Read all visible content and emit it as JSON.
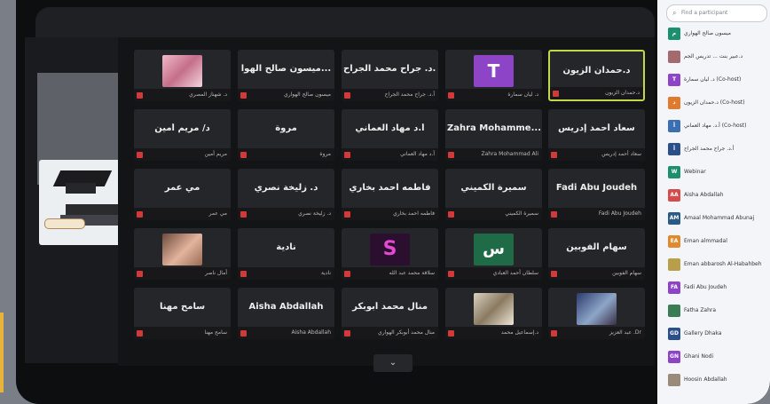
{
  "search": {
    "placeholder": "Find a participant"
  },
  "tiles": [
    {
      "name": "",
      "caption": "د. شهناز المصري",
      "avatar": "photo-pink"
    },
    {
      "name": "ميسون صالح الهوا...",
      "caption": "ميسون صالح الهواري",
      "avatar": null
    },
    {
      "name": "أ.د. جراح محمد الجراح",
      "caption": "أ.د. جراح محمد الجراح",
      "avatar": null
    },
    {
      "name": "",
      "caption": "د. ليان سمارة",
      "avatar": "purpleT",
      "letter": "T"
    },
    {
      "name": "د.حمدان الزيون",
      "caption": "د.حمدان الزيون",
      "avatar": null,
      "selected": true
    },
    {
      "name": "د/ مريم أمين",
      "caption": "مريم أمين",
      "avatar": null
    },
    {
      "name": "مروة",
      "caption": "مروة",
      "avatar": null
    },
    {
      "name": "أ.د مهاد العماني",
      "caption": "أ.د مهاد العماني",
      "avatar": null
    },
    {
      "name": "Zahra Mohamme...",
      "caption": "Zahra Mohammad Ali",
      "avatar": null
    },
    {
      "name": "سعاد أحمد إدريس",
      "caption": "سعاد أحمد إدريس",
      "avatar": null
    },
    {
      "name": "مي عمر",
      "caption": "مي عمر",
      "avatar": null
    },
    {
      "name": "د. زليخة نصري",
      "caption": "د. زليخة نصري",
      "avatar": null
    },
    {
      "name": "فاطمه احمد بخاري",
      "caption": "فاطمه احمد بخاري",
      "avatar": null
    },
    {
      "name": "سميرة الكميني",
      "caption": "سميرة الكميني",
      "avatar": null
    },
    {
      "name": "Fadi Abu Joudeh",
      "caption": "Fadi Abu Joudeh",
      "avatar": null
    },
    {
      "name": "",
      "caption": "أمال ناصر",
      "avatar": "photo-warm"
    },
    {
      "name": "نادية",
      "caption": "نادية",
      "avatar": null
    },
    {
      "name": "",
      "caption": "سلافة محمد عبد الله",
      "avatar": "purpleS",
      "letter": "S"
    },
    {
      "name": "",
      "caption": "سلطان أحمد العبادي",
      "avatar": "green",
      "letter": "س"
    },
    {
      "name": "سهام الفوبين",
      "caption": "سهام الفوبين",
      "avatar": null
    },
    {
      "name": "سامح مهنا",
      "caption": "سامح مهنا",
      "avatar": null
    },
    {
      "name": "Aisha Abdallah",
      "caption": "Aisha Abdallah",
      "avatar": null
    },
    {
      "name": "منال محمد أبوبكر",
      "caption": "منال محمد أبوبكر الهواري",
      "avatar": null
    },
    {
      "name": "",
      "caption": "د.إسماعيل محمد",
      "avatar": "photo-book"
    },
    {
      "name": "",
      "caption": "Dr. عبد العزيز",
      "avatar": "photo-blue"
    }
  ],
  "participants": [
    {
      "name": "ميسون صالح الهواري",
      "color": "#1c8f6e",
      "initials": "م"
    },
    {
      "name": "د.عبير بنت ... تدريس الجم",
      "color": "#a46a6f",
      "initials": ""
    },
    {
      "name": "د. ليان سمارة (Co-host)",
      "color": "#8d44c7",
      "initials": "T"
    },
    {
      "name": "د.حمدان الزيون (Co-host)",
      "color": "#e07b2e",
      "initials": "د"
    },
    {
      "name": "أ.د. مهاد العماني (Co-host)",
      "color": "#3b6fb3",
      "initials": "أ"
    },
    {
      "name": "أ.د. جراح محمد الجراح",
      "color": "#2a4f8a",
      "initials": "أ"
    },
    {
      "name": "Webinar",
      "color": "#1c8f6e",
      "initials": "W"
    },
    {
      "name": "Aisha Abdallah",
      "color": "#d64a4a",
      "initials": "AA"
    },
    {
      "name": "Amaal Mohammad Abunaj",
      "color": "#2a5a86",
      "initials": "AM"
    },
    {
      "name": "Eman almmadal",
      "color": "#e08a2e",
      "initials": "EA"
    },
    {
      "name": "Eman abbarosh Al-Habahbeh",
      "color": "#b8a04a",
      "initials": ""
    },
    {
      "name": "Fadi Abu Joudeh",
      "color": "#8d44c7",
      "initials": "FA"
    },
    {
      "name": "Fatha Zahra",
      "color": "#3a7d55",
      "initials": ""
    },
    {
      "name": "Gallery Dhaka",
      "color": "#2a4f8a",
      "initials": "GD"
    },
    {
      "name": "Ghani Nodi",
      "color": "#8d44c7",
      "initials": "GN"
    },
    {
      "name": "Hoosin Abdallah",
      "color": "#9a8a7a",
      "initials": ""
    }
  ],
  "controls": {
    "more_label": "⌄"
  }
}
